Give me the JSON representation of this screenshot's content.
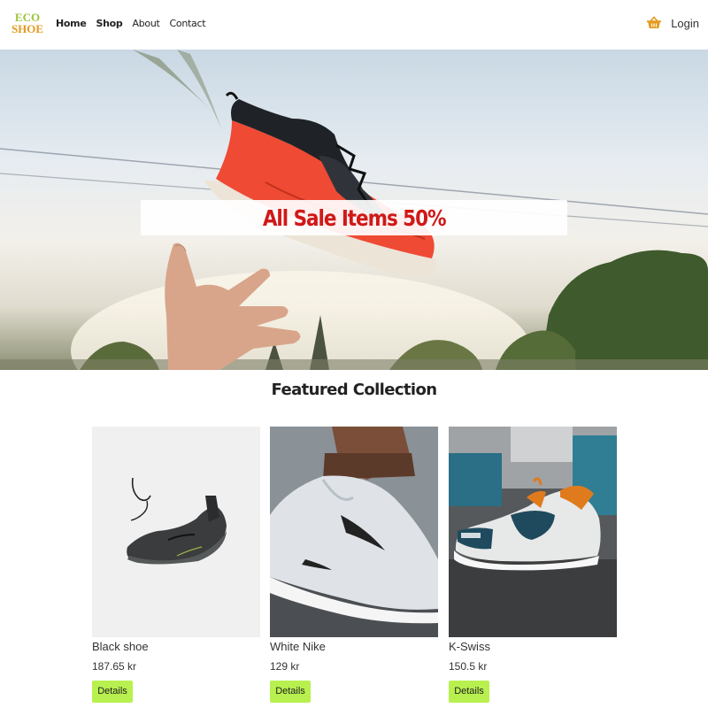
{
  "brand": {
    "line1": "ECO",
    "line2": "SHOE",
    "color1": "#9bc43a",
    "color2": "#e39a1e"
  },
  "nav": {
    "items": [
      {
        "label": "Home",
        "bold": true
      },
      {
        "label": "Shop",
        "bold": true
      },
      {
        "label": "About",
        "bold": false
      },
      {
        "label": "Contact",
        "bold": false
      }
    ]
  },
  "header": {
    "cart_icon": "basket-icon",
    "login_label": "Login"
  },
  "hero": {
    "banner_text": "All Sale Items 50%",
    "banner_color": "#d11818"
  },
  "featured": {
    "title": "Featured Collection",
    "products": [
      {
        "name": "Black shoe",
        "price": "187.65 kr",
        "button": "Details"
      },
      {
        "name": "White Nike",
        "price": "129 kr",
        "button": "Details"
      },
      {
        "name": "K-Swiss",
        "price": "150.5 kr",
        "button": "Details"
      }
    ]
  },
  "colors": {
    "button_bg": "#b8f050",
    "accent": "#e39a1e"
  }
}
